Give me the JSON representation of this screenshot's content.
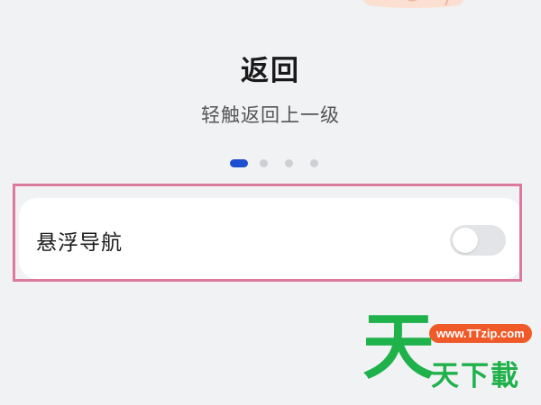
{
  "header": {
    "title": "返回",
    "subtitle": "轻触返回上一级"
  },
  "pager": {
    "total": 4,
    "active_index": 0,
    "active_color": "#1f4fd1"
  },
  "setting": {
    "label": "悬浮导航",
    "toggle_on": false
  },
  "watermark": {
    "big_char": "天",
    "badge": "www.TTzip.com",
    "text": "天下載",
    "color": "#1fb14a",
    "badge_color": "#f05a28"
  },
  "highlight_color": "#dd7a9c"
}
